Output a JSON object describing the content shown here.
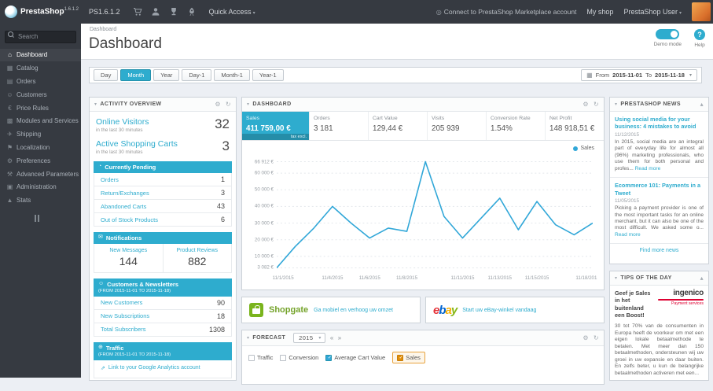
{
  "colors": {
    "accent": "#2eacce",
    "topbar": "#363a41",
    "orange": "#e08f0b",
    "chart_line": "#31a7d8",
    "ebay": [
      "#e53238",
      "#0064d2",
      "#f5af02",
      "#86b817"
    ]
  },
  "icons": {
    "gear": "⚙",
    "refresh": "↻",
    "caret_down": "▾",
    "caret_up": "▴",
    "calendar": "▦",
    "clock": "◔",
    "mail": "✉",
    "users": "☺",
    "traffic": "⊕",
    "link": "⇗",
    "marketplace": "◎",
    "prev": "«",
    "next": "»"
  },
  "topbar": {
    "brand": "PrestaShop",
    "brand_version": "1.6.1.2",
    "shop_tag": "PS1.6.1.2",
    "quick_access_label": "Quick Access",
    "marketplace_link": "Connect to PrestaShop Marketplace account",
    "my_shop_label": "My shop",
    "user_label": "PrestaShop User"
  },
  "sidebar": {
    "search_placeholder": "Search",
    "items": [
      {
        "label": "Dashboard",
        "glyph": "⌂"
      },
      {
        "label": "Catalog",
        "glyph": "▦"
      },
      {
        "label": "Orders",
        "glyph": "▤"
      },
      {
        "label": "Customers",
        "glyph": "☺"
      },
      {
        "label": "Price Rules",
        "glyph": "€"
      },
      {
        "label": "Modules and Services",
        "glyph": "▩"
      },
      {
        "label": "Shipping",
        "glyph": "✈"
      },
      {
        "label": "Localization",
        "glyph": "⚑"
      },
      {
        "label": "Preferences",
        "glyph": "⚙"
      },
      {
        "label": "Advanced Parameters",
        "glyph": "⚒"
      },
      {
        "label": "Administration",
        "glyph": "▣"
      },
      {
        "label": "Stats",
        "glyph": "▲"
      }
    ]
  },
  "header": {
    "breadcrumb": "Dashboard",
    "title": "Dashboard",
    "demo_mode_label": "Demo mode",
    "help_label": "Help",
    "help_glyph": "?"
  },
  "filters": {
    "buttons": [
      "Day",
      "Month",
      "Year",
      "Day-1",
      "Month-1",
      "Year-1"
    ],
    "active": "Month",
    "from_label": "From",
    "from_date": "2015-11-01",
    "to_label": "To",
    "to_date": "2015-11-18"
  },
  "activity": {
    "title": "ACTIVITY OVERVIEW",
    "online_visitors": {
      "label": "Online Visitors",
      "sub": "in the last 30 minutes",
      "value": "32"
    },
    "active_carts": {
      "label": "Active Shopping Carts",
      "sub": "in the last 30 minutes",
      "value": "3"
    },
    "pending": {
      "title": "Currently Pending",
      "rows": [
        {
          "label": "Orders",
          "value": "1"
        },
        {
          "label": "Return/Exchanges",
          "value": "3"
        },
        {
          "label": "Abandoned Carts",
          "value": "43"
        },
        {
          "label": "Out of Stock Products",
          "value": "6"
        }
      ]
    },
    "notifications": {
      "title": "Notifications",
      "cells": [
        {
          "label": "New Messages",
          "value": "144"
        },
        {
          "label": "Product Reviews",
          "value": "882"
        }
      ]
    },
    "customers": {
      "title": "Customers & Newsletters",
      "subtitle": "(FROM 2015-11-01 TO 2015-11-18)",
      "rows": [
        {
          "label": "New Customers",
          "value": "90"
        },
        {
          "label": "New Subscriptions",
          "value": "18"
        },
        {
          "label": "Total Subscribers",
          "value": "1308"
        }
      ]
    },
    "traffic": {
      "title": "Traffic",
      "subtitle": "(FROM 2015-11-01 TO 2015-11-18)",
      "link": "Link to your Google Analytics account"
    }
  },
  "dashboard_panel": {
    "title": "DASHBOARD",
    "kpis": [
      {
        "label": "Sales",
        "value": "411 759,00 €",
        "note": "tax excl."
      },
      {
        "label": "Orders",
        "value": "3 181"
      },
      {
        "label": "Cart Value",
        "value": "129,44 €"
      },
      {
        "label": "Visits",
        "value": "205 939"
      },
      {
        "label": "Conversion Rate",
        "value": "1.54%"
      },
      {
        "label": "Net Profit",
        "value": "148 918,51 €"
      }
    ],
    "legend": "Sales"
  },
  "chart_data": {
    "type": "line",
    "title": "Sales",
    "legend": [
      "Sales"
    ],
    "legend_position": "top-right",
    "grid": true,
    "line_color": "#31a7d8",
    "x": [
      "11/1",
      "11/2",
      "11/3",
      "11/4",
      "11/5",
      "11/6",
      "11/7",
      "11/8",
      "11/9",
      "11/10",
      "11/11",
      "11/12",
      "11/13",
      "11/14",
      "11/15",
      "11/16",
      "11/17",
      "11/18"
    ],
    "values": [
      3082,
      16000,
      27000,
      40000,
      30000,
      21000,
      27000,
      25000,
      66912,
      34000,
      21000,
      33000,
      45000,
      26000,
      43000,
      29000,
      23000,
      30000
    ],
    "ylim": [
      0,
      70000
    ],
    "y_ticks": [
      {
        "v": 66912,
        "label": "66 912 €"
      },
      {
        "v": 60000,
        "label": "60 000 €"
      },
      {
        "v": 50000,
        "label": "50 000 €"
      },
      {
        "v": 40000,
        "label": "40 000 €"
      },
      {
        "v": 30000,
        "label": "30 000 €"
      },
      {
        "v": 20000,
        "label": "20 000 €"
      },
      {
        "v": 10000,
        "label": "10 000 €"
      },
      {
        "v": 3082,
        "label": "3 082 €"
      }
    ],
    "x_tick_labels": [
      "11/1/2015",
      "11/4/2015",
      "11/6/2015",
      "11/8/2015",
      "11/11/2015",
      "11/13/2015",
      "11/15/2015",
      "11/18/201"
    ],
    "x_tick_positions": [
      0,
      3,
      5,
      7,
      10,
      12,
      14,
      17
    ]
  },
  "promos": [
    {
      "brand": "Shopgate",
      "link": "Ga mobiel en verhoog uw omzet"
    },
    {
      "letters": [
        {
          "ch": "e",
          "color": "#e53238"
        },
        {
          "ch": "b",
          "color": "#0064d2"
        },
        {
          "ch": "a",
          "color": "#f5af02"
        },
        {
          "ch": "y",
          "color": "#86b817"
        }
      ],
      "link": "Start uw eBay-winkel vandaag"
    }
  ],
  "forecast": {
    "title": "FORECAST",
    "year": "2015",
    "legend": [
      "Traffic",
      "Conversion",
      "Average Cart Value",
      "Sales"
    ]
  },
  "news": {
    "title": "PRESTASHOP NEWS",
    "articles": [
      {
        "title": "Using social media for your business: 4 mistakes to avoid",
        "date": "11/12/2015",
        "excerpt": "In 2015, social media are an integral part of everyday life for almost all (96%) marketing professionals, who use them for both personal and profes...",
        "read_more": "Read more"
      },
      {
        "title": "Ecommerce 101: Payments in a Tweet",
        "date": "11/05/2015",
        "excerpt": "Picking a payment provider is one of the most important tasks for an online merchant, but it can also be one of the most difficult. We asked some o...",
        "read_more": "Read more"
      }
    ],
    "find_more": "Find more news"
  },
  "tips": {
    "title": "TIPS OF THE DAY",
    "headline": "Geef je Sales in het buitenland een Boost!",
    "brand": "ingenico",
    "brand_tagline": "Payment services",
    "body": "30 tot 70% van de consumenten in Europa heeft de voorkeur om met een eigen lokale betaalmethode te betalen. Met meer dan 150 betaalmethoden, ondersteunen wij uw groei in uw expansie en daar buiten. En zelfs beter, u kun de belangrijke betaalmethoden activeren met een..."
  }
}
